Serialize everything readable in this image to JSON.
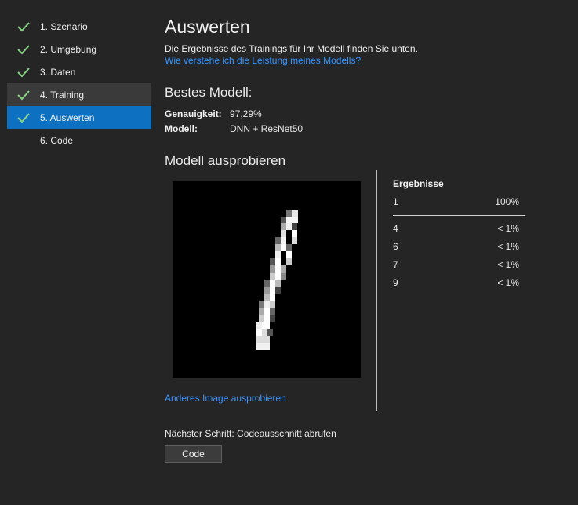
{
  "sidebar": {
    "items": [
      {
        "label": "1. Szenario",
        "checked": true,
        "state": "normal"
      },
      {
        "label": "2. Umgebung",
        "checked": true,
        "state": "normal"
      },
      {
        "label": "3. Daten",
        "checked": true,
        "state": "normal"
      },
      {
        "label": "4. Training",
        "checked": true,
        "state": "hover"
      },
      {
        "label": "5. Auswerten",
        "checked": true,
        "state": "active"
      },
      {
        "label": "6. Code",
        "checked": false,
        "state": "normal"
      }
    ],
    "check_color": "#89d185"
  },
  "main": {
    "title": "Auswerten",
    "subtitle": "Die Ergebnisse des Trainings für Ihr Modell finden Sie unten.",
    "help_link": "Wie verstehe ich die Leistung meines Modells?",
    "best_model": {
      "heading": "Bestes Modell:",
      "accuracy_label": "Genauigkeit:",
      "accuracy_value": "97,29%",
      "model_label": "Modell:",
      "model_value": "DNN + ResNet50"
    },
    "try_model": {
      "heading": "Modell ausprobieren",
      "other_image_link": "Anderes Image ausprobieren"
    },
    "results": {
      "heading": "Ergebnisse",
      "rows": [
        {
          "class": "1",
          "prob": "100%"
        },
        {
          "class": "4",
          "prob": "< 1%"
        },
        {
          "class": "6",
          "prob": "< 1%"
        },
        {
          "class": "7",
          "prob": "< 1%"
        },
        {
          "class": "9",
          "prob": "< 1%"
        }
      ]
    },
    "next_step": "Nächster Schritt: Codeausschnitt abrufen",
    "code_button": "Code"
  },
  "colors": {
    "accent": "#0e70c0",
    "link": "#3794ff",
    "background": "#252526"
  }
}
